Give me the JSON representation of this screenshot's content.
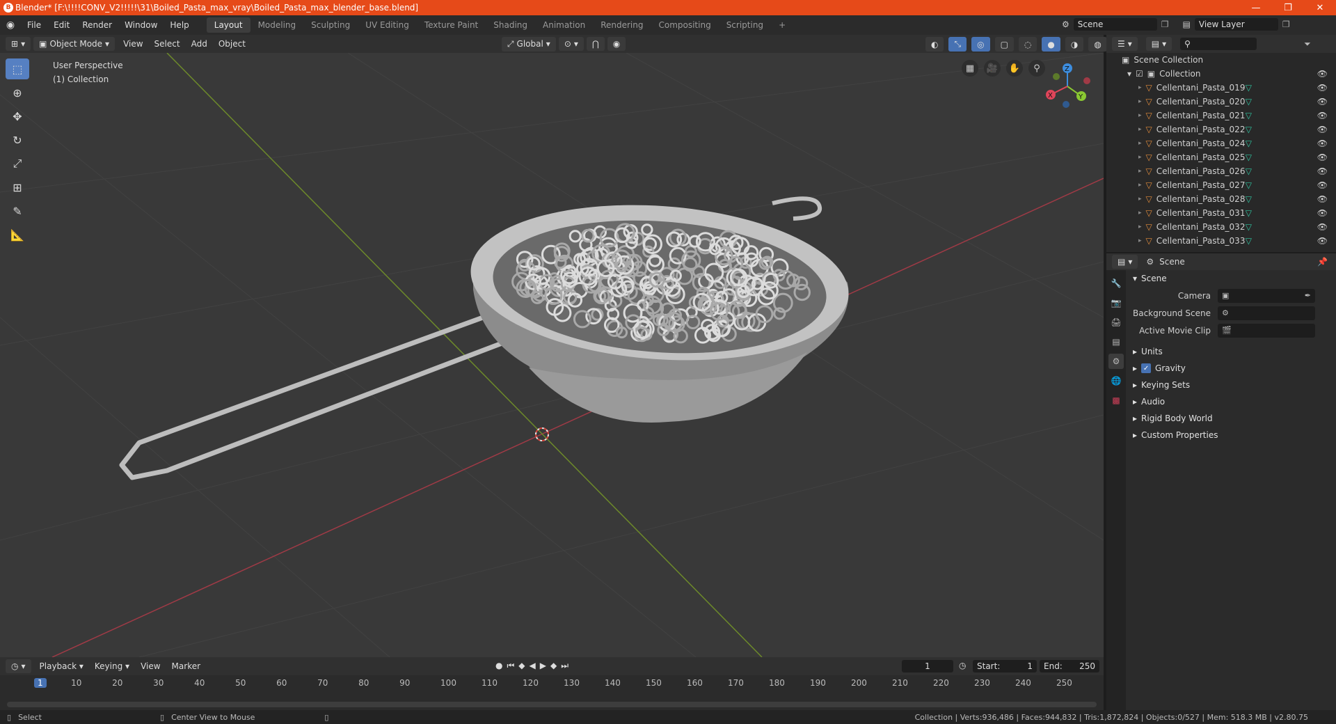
{
  "window": {
    "title": "Blender* [F:\\!!!!CONV_V2!!!!!\\31\\Boiled_Pasta_max_vray\\Boiled_Pasta_max_blender_base.blend]",
    "min": "—",
    "max": "❐",
    "close": "✕"
  },
  "menu": [
    "File",
    "Edit",
    "Render",
    "Window",
    "Help"
  ],
  "workspaces": [
    "Layout",
    "Modeling",
    "Sculpting",
    "UV Editing",
    "Texture Paint",
    "Shading",
    "Animation",
    "Rendering",
    "Compositing",
    "Scripting"
  ],
  "active_workspace": "Layout",
  "add_workspace": "+",
  "scene_field": "Scene",
  "view_layer_field": "View Layer",
  "viewport_header": {
    "mode": "Object Mode",
    "items": [
      "View",
      "Select",
      "Add",
      "Object"
    ],
    "orientation": "Global"
  },
  "viewport": {
    "view_name": "User Perspective",
    "collection": "(1) Collection",
    "gizmo": {
      "x": "X",
      "y": "Y",
      "z": "Z"
    }
  },
  "outliner": {
    "root": "Scene Collection",
    "collection": "Collection",
    "items": [
      "Cellentani_Pasta_019",
      "Cellentani_Pasta_020",
      "Cellentani_Pasta_021",
      "Cellentani_Pasta_022",
      "Cellentani_Pasta_024",
      "Cellentani_Pasta_025",
      "Cellentani_Pasta_026",
      "Cellentani_Pasta_027",
      "Cellentani_Pasta_028",
      "Cellentani_Pasta_031",
      "Cellentani_Pasta_032",
      "Cellentani_Pasta_033"
    ]
  },
  "properties": {
    "context": "Scene",
    "section": "Scene",
    "fields": [
      {
        "label": "Camera",
        "value": ""
      },
      {
        "label": "Background Scene",
        "value": ""
      },
      {
        "label": "Active Movie Clip",
        "value": ""
      }
    ],
    "panels": [
      "Units",
      "Gravity",
      "Keying Sets",
      "Audio",
      "Rigid Body World",
      "Custom Properties"
    ],
    "gravity_checked": true
  },
  "timeline": {
    "menus": [
      "Playback",
      "Keying",
      "View",
      "Marker"
    ],
    "current_frame": "1",
    "start_label": "Start:",
    "start": "1",
    "end_label": "End:",
    "end": "250",
    "ruler": [
      "1",
      "10",
      "20",
      "30",
      "40",
      "50",
      "60",
      "70",
      "80",
      "90",
      "100",
      "110",
      "120",
      "130",
      "140",
      "150",
      "160",
      "170",
      "180",
      "190",
      "200",
      "210",
      "220",
      "230",
      "240",
      "250"
    ]
  },
  "status": {
    "left": "Select",
    "middle": "Center View to Mouse",
    "right": "Collection | Verts:936,486 | Faces:944,832 | Tris:1,872,824 | Objects:0/527 | Mem: 518.3 MB | v2.80.75"
  },
  "colors": {
    "title_bar": "#e64a19",
    "active_tool": "#5680c2",
    "x_axis": "#e0455a",
    "y_axis": "#8ac832",
    "z_axis": "#3d8ee0",
    "mesh_icon": "#e08b3c",
    "data_icon": "#2fc4a0"
  }
}
